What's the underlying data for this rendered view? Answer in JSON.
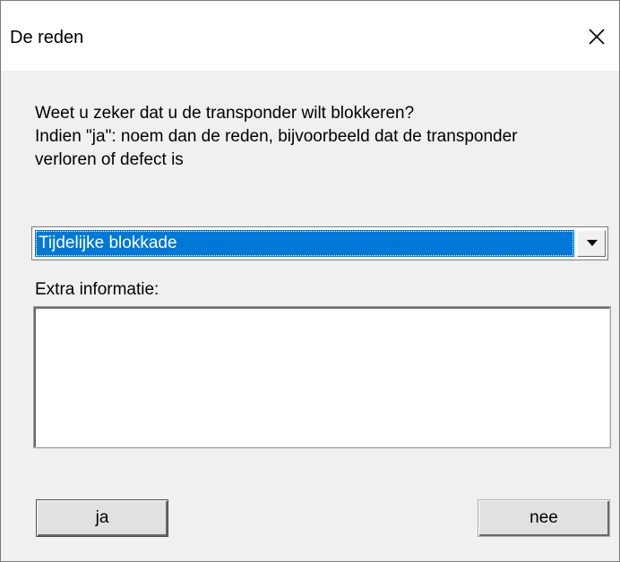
{
  "dialog": {
    "title": "De reden",
    "close_icon": "close-icon"
  },
  "message": {
    "line1": "Weet u zeker dat u de transponder wilt blokkeren?",
    "line2": "Indien \"ja\": noem dan de reden, bijvoorbeeld dat de transponder",
    "line3": "verloren of defect is"
  },
  "reason_select": {
    "selected": "Tijdelijke blokkade",
    "dropdown_icon": "chevron-down-icon",
    "highlight_color": "#0078d7"
  },
  "extra_info": {
    "label": "Extra informatie:",
    "value": ""
  },
  "buttons": {
    "yes_label": "ja",
    "no_label": "nee"
  }
}
